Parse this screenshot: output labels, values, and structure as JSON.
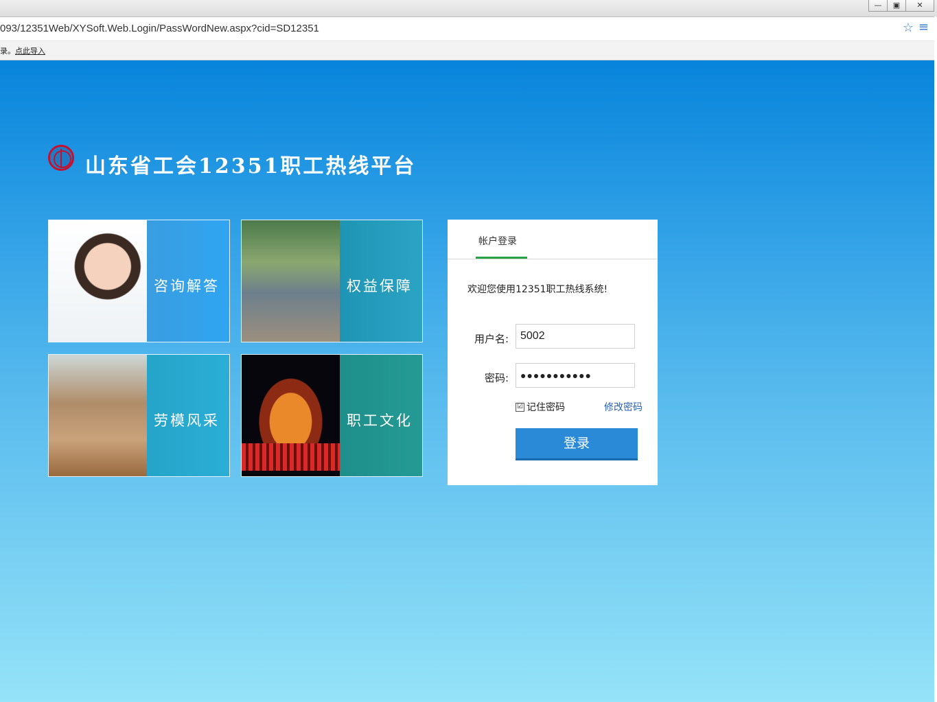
{
  "browser": {
    "url": "093/12351Web/XYSoft.Web.Login/PassWordNew.aspx?cid=SD12351",
    "bookmark_left": "录。",
    "bookmark_link": "点此导入",
    "window_buttons": [
      "—",
      "▣",
      "✕"
    ]
  },
  "header": {
    "title": "山东省工会12351职工热线平台"
  },
  "tiles": [
    {
      "label": "咨询解答"
    },
    {
      "label": "权益保障"
    },
    {
      "label": "劳模风采"
    },
    {
      "label": "职工文化"
    }
  ],
  "login": {
    "tab_label": "帐户登录",
    "welcome": "欢迎您使用12351职工热线系统!",
    "username_label": "用户名:",
    "username_value": "5002",
    "password_label": "密码:",
    "password_value": "●●●●●●●●●●●",
    "remember_label": "记住密码",
    "remember_checked": "☑",
    "change_password_label": "修改密码",
    "submit_label": "登录"
  },
  "colors": {
    "page_top": "#0784db",
    "page_bottom": "#95e3f8",
    "accent_tab": "#27a345",
    "button": "#2b8ad8"
  }
}
